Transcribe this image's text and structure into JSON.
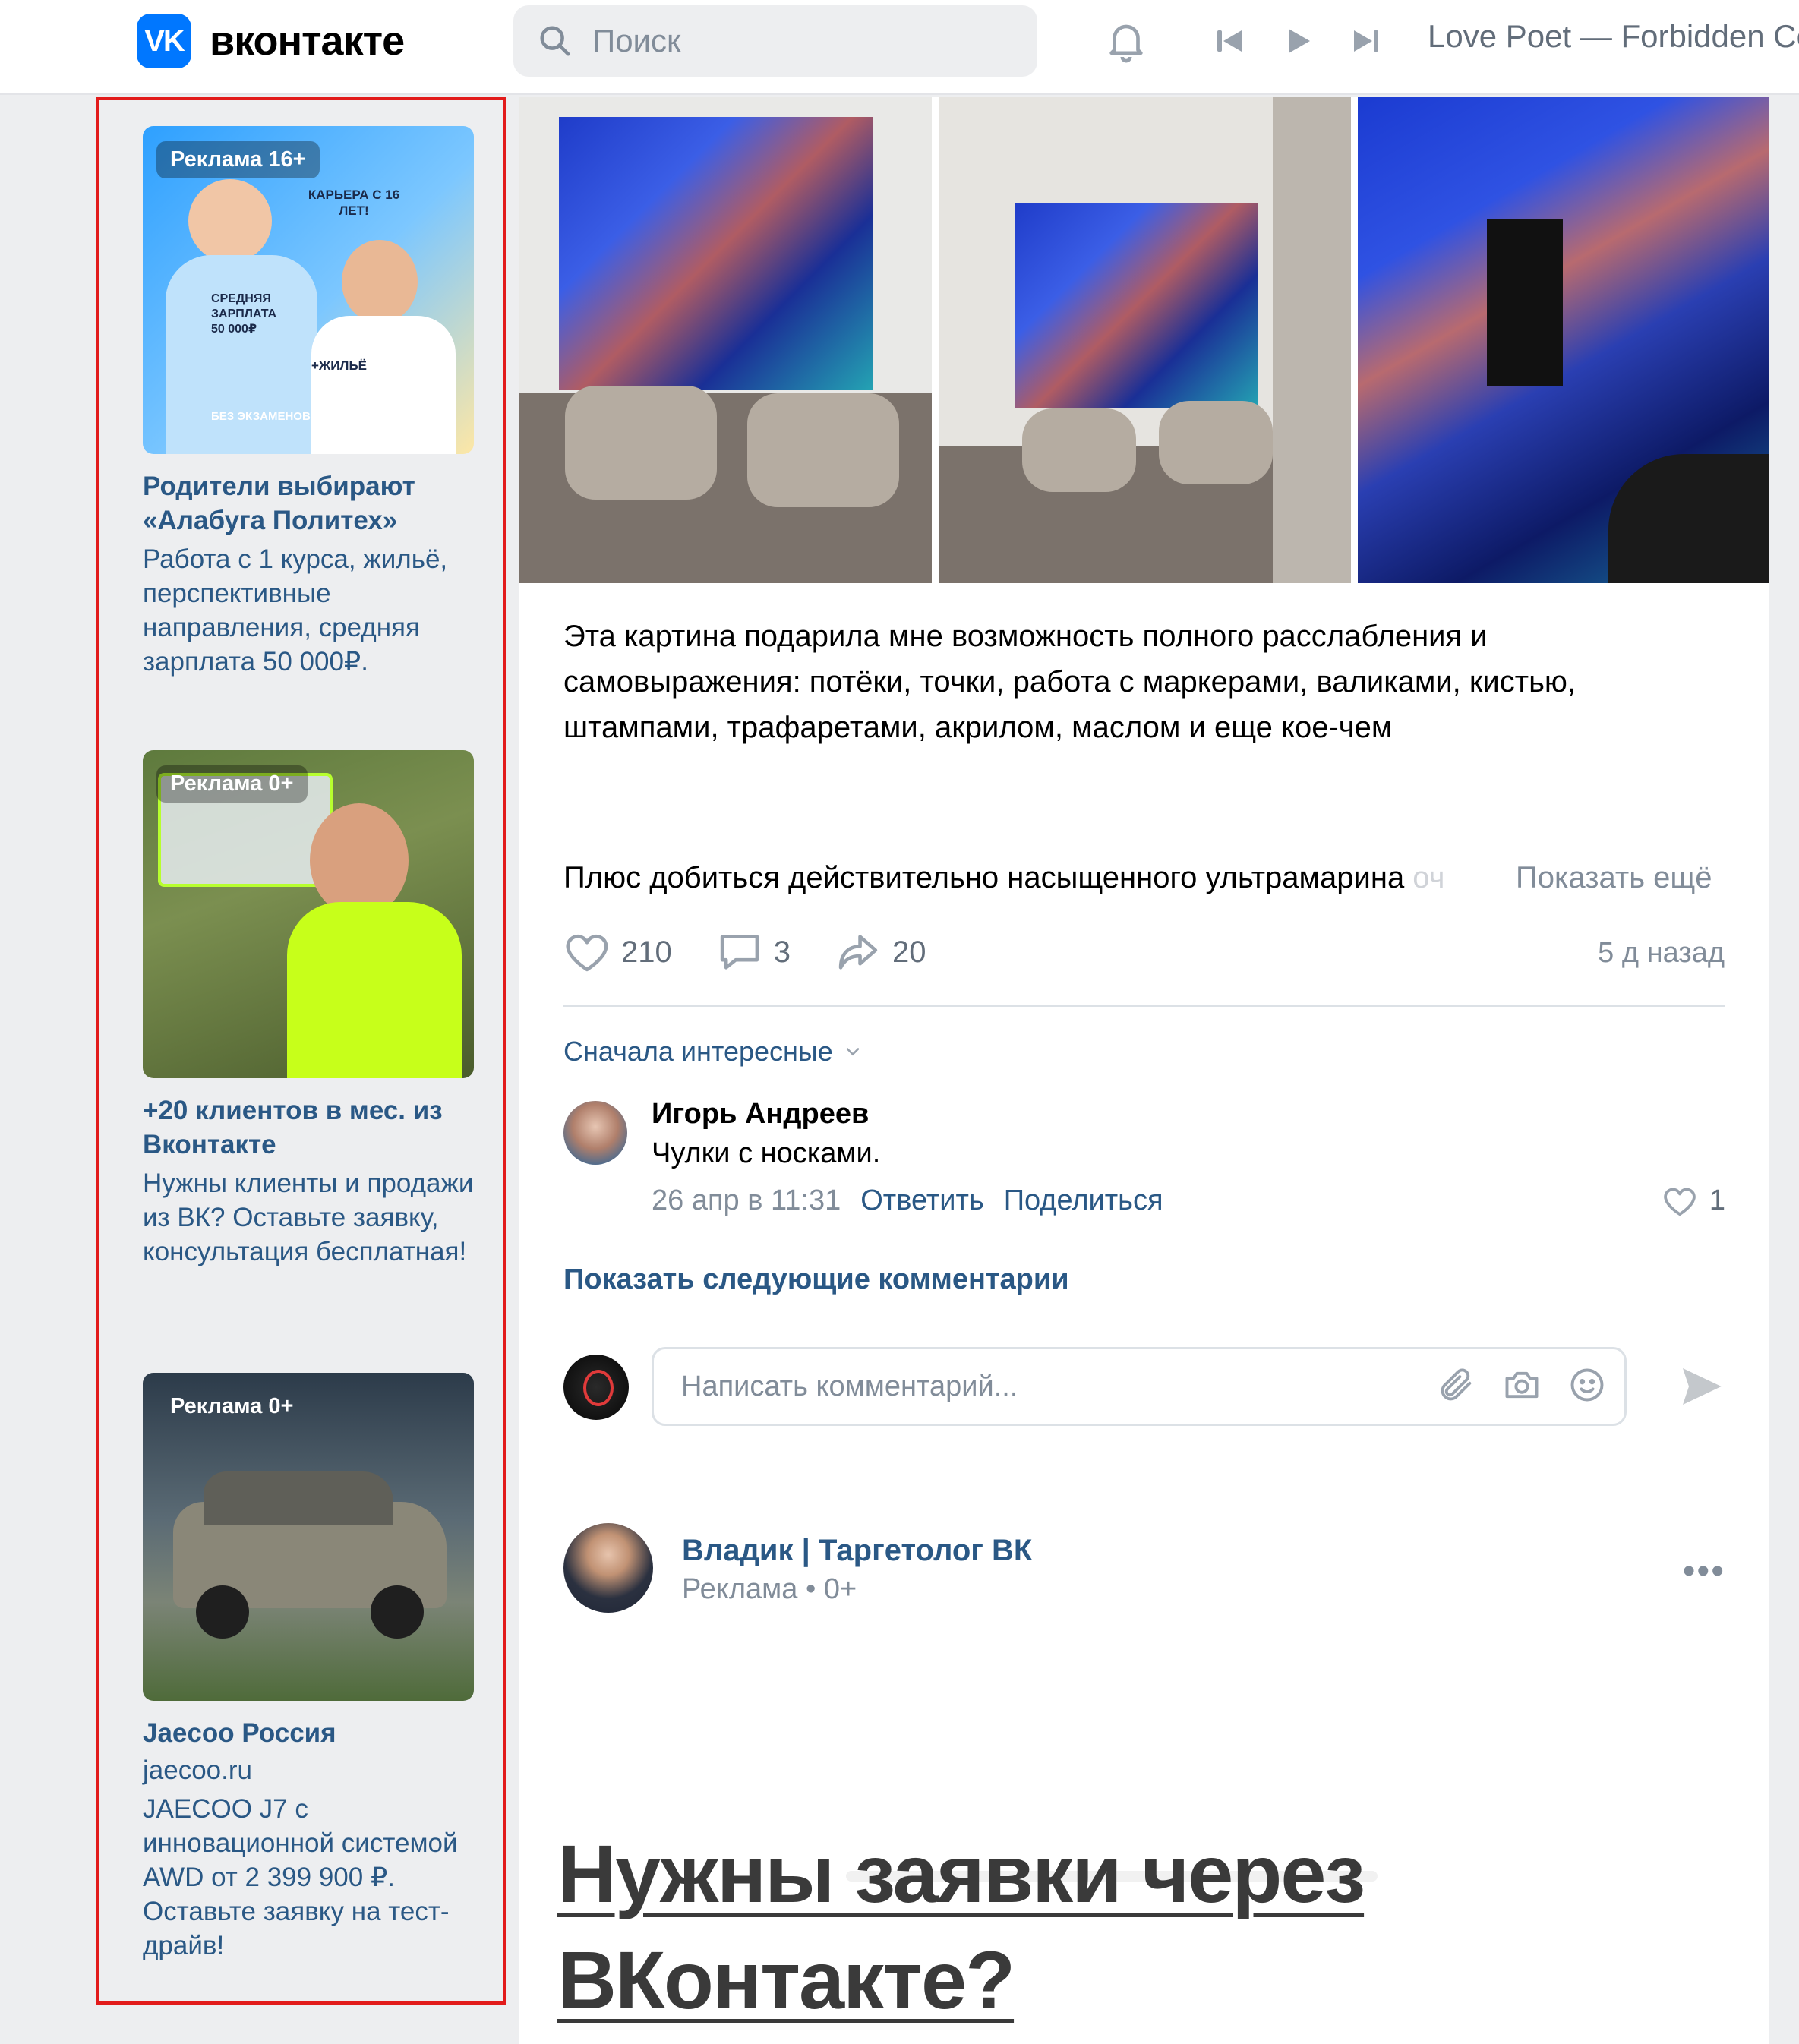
{
  "header": {
    "logo_mark": "VK",
    "logo_text": "вконтакте",
    "search_placeholder": "Поиск",
    "track": "Love Poet — Forbidden Co"
  },
  "ads": [
    {
      "badge": "Реклама 16+",
      "title": "Родители выбирают «Алабуга Политех»",
      "domain": "",
      "text": "Работа с 1 курса, жильё, перспективные направления, средняя зарплата 50 000₽.",
      "image_text": [
        "КАРЬЕРА С 16 ЛЕТ!",
        "СРЕДНЯЯ ЗАРПЛАТА 50 000₽",
        "+ЖИЛЬЁ",
        "БЕЗ ЭКЗАМЕНОВ!"
      ]
    },
    {
      "badge": "Реклама 0+",
      "title": "+20 клиентов в мес. из Вконтакте",
      "domain": "",
      "text": "Нужны клиенты и продажи из ВК? Оставьте заявку, консультация бесплатная!"
    },
    {
      "badge": "Реклама 0+",
      "title": "Jaecoo Россия",
      "domain": "jaecoo.ru",
      "text": "JAECOO J7 с инновационной системой AWD от 2 399 900 ₽. Оставьте заявку на тест-драйв!"
    }
  ],
  "post": {
    "text": "Эта картина подарила мне возможность полного расслабления и самовыражения: потёки, точки, работа с маркерами, валиками, кистью, штампами, трафаретами, акрилом, маслом и еще кое-чем",
    "text2": "Плюс добиться действительно насыщенного ультрамарина",
    "text2_fade": " оч",
    "show_more": "Показать ещё",
    "likes": "210",
    "comments": "3",
    "shares": "20",
    "date": "5 д назад",
    "sort_label": "Сначала интересные",
    "comment": {
      "author": "Игорь Андреев",
      "text": "Чулки с носками.",
      "time": "26 апр в 11:31",
      "reply": "Ответить",
      "share": "Поделиться",
      "likes": "1"
    },
    "more_comments": "Показать следующие комментарии",
    "composer_placeholder": "Написать комментарий..."
  },
  "next_post": {
    "author": "Владик | Таргетолог ВК",
    "subtitle": "Реклама • 0+",
    "dots": "•••",
    "heading": "Нужны заявки через ВКонтакте?"
  }
}
